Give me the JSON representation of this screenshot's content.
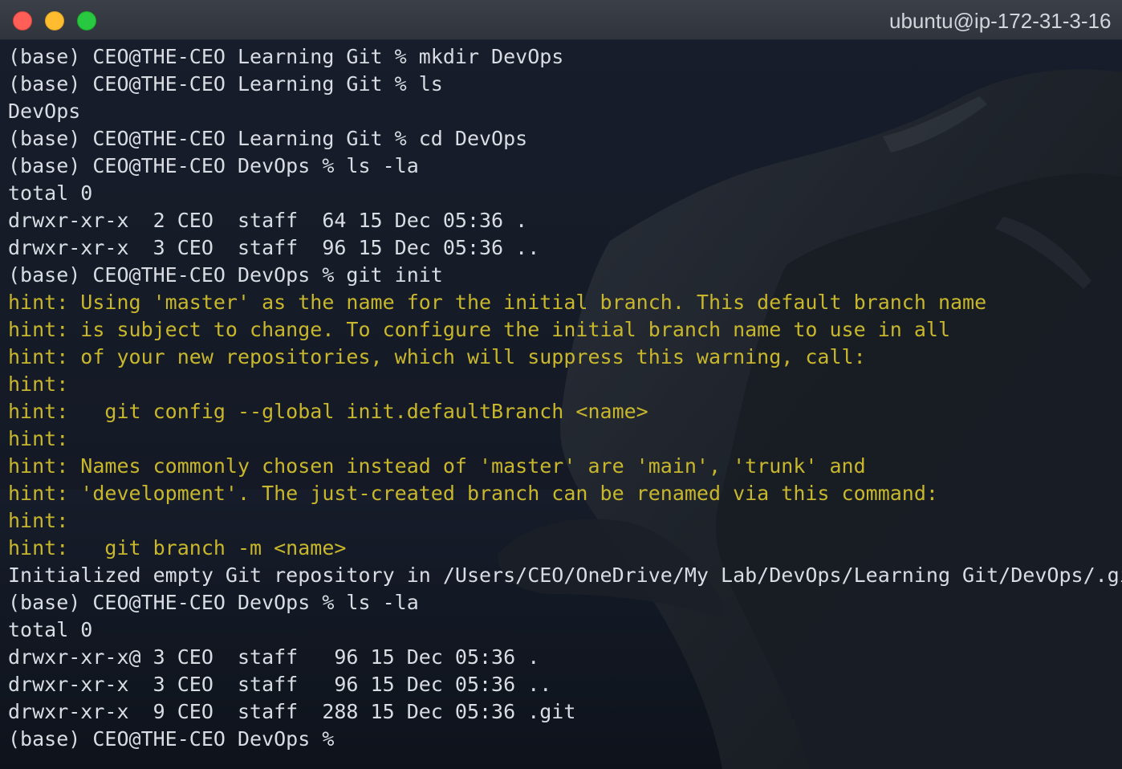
{
  "window": {
    "title": "ubuntu@ip-172-31-3-16"
  },
  "colors": {
    "normal_text": "#d9dde3",
    "hint_text": "#c8b72c",
    "close_button": "#ff5f57",
    "minimize_button": "#febc2e",
    "maximize_button": "#28c840"
  },
  "terminal": {
    "lines": [
      {
        "text": "(base) CEO@THE-CEO Learning Git % mkdir DevOps",
        "kind": "normal"
      },
      {
        "text": "(base) CEO@THE-CEO Learning Git % ls",
        "kind": "normal"
      },
      {
        "text": "DevOps",
        "kind": "normal"
      },
      {
        "text": "(base) CEO@THE-CEO Learning Git % cd DevOps",
        "kind": "normal"
      },
      {
        "text": "(base) CEO@THE-CEO DevOps % ls -la",
        "kind": "normal"
      },
      {
        "text": "total 0",
        "kind": "normal"
      },
      {
        "text": "drwxr-xr-x  2 CEO  staff  64 15 Dec 05:36 .",
        "kind": "normal"
      },
      {
        "text": "drwxr-xr-x  3 CEO  staff  96 15 Dec 05:36 ..",
        "kind": "normal"
      },
      {
        "text": "(base) CEO@THE-CEO DevOps % git init",
        "kind": "normal"
      },
      {
        "text": "hint: Using 'master' as the name for the initial branch. This default branch name",
        "kind": "hint"
      },
      {
        "text": "hint: is subject to change. To configure the initial branch name to use in all",
        "kind": "hint"
      },
      {
        "text": "hint: of your new repositories, which will suppress this warning, call:",
        "kind": "hint"
      },
      {
        "text": "hint:",
        "kind": "hint"
      },
      {
        "text": "hint:   git config --global init.defaultBranch <name>",
        "kind": "hint"
      },
      {
        "text": "hint:",
        "kind": "hint"
      },
      {
        "text": "hint: Names commonly chosen instead of 'master' are 'main', 'trunk' and",
        "kind": "hint"
      },
      {
        "text": "hint: 'development'. The just-created branch can be renamed via this command:",
        "kind": "hint"
      },
      {
        "text": "hint:",
        "kind": "hint"
      },
      {
        "text": "hint:   git branch -m <name>",
        "kind": "hint"
      },
      {
        "text": "Initialized empty Git repository in /Users/CEO/OneDrive/My Lab/DevOps/Learning Git/DevOps/.git/",
        "kind": "normal"
      },
      {
        "text": "(base) CEO@THE-CEO DevOps % ls -la",
        "kind": "normal"
      },
      {
        "text": "total 0",
        "kind": "normal"
      },
      {
        "text": "drwxr-xr-x@ 3 CEO  staff   96 15 Dec 05:36 .",
        "kind": "normal"
      },
      {
        "text": "drwxr-xr-x  3 CEO  staff   96 15 Dec 05:36 ..",
        "kind": "normal"
      },
      {
        "text": "drwxr-xr-x  9 CEO  staff  288 15 Dec 05:36 .git",
        "kind": "normal"
      },
      {
        "text": "(base) CEO@THE-CEO DevOps %",
        "kind": "normal"
      }
    ]
  }
}
